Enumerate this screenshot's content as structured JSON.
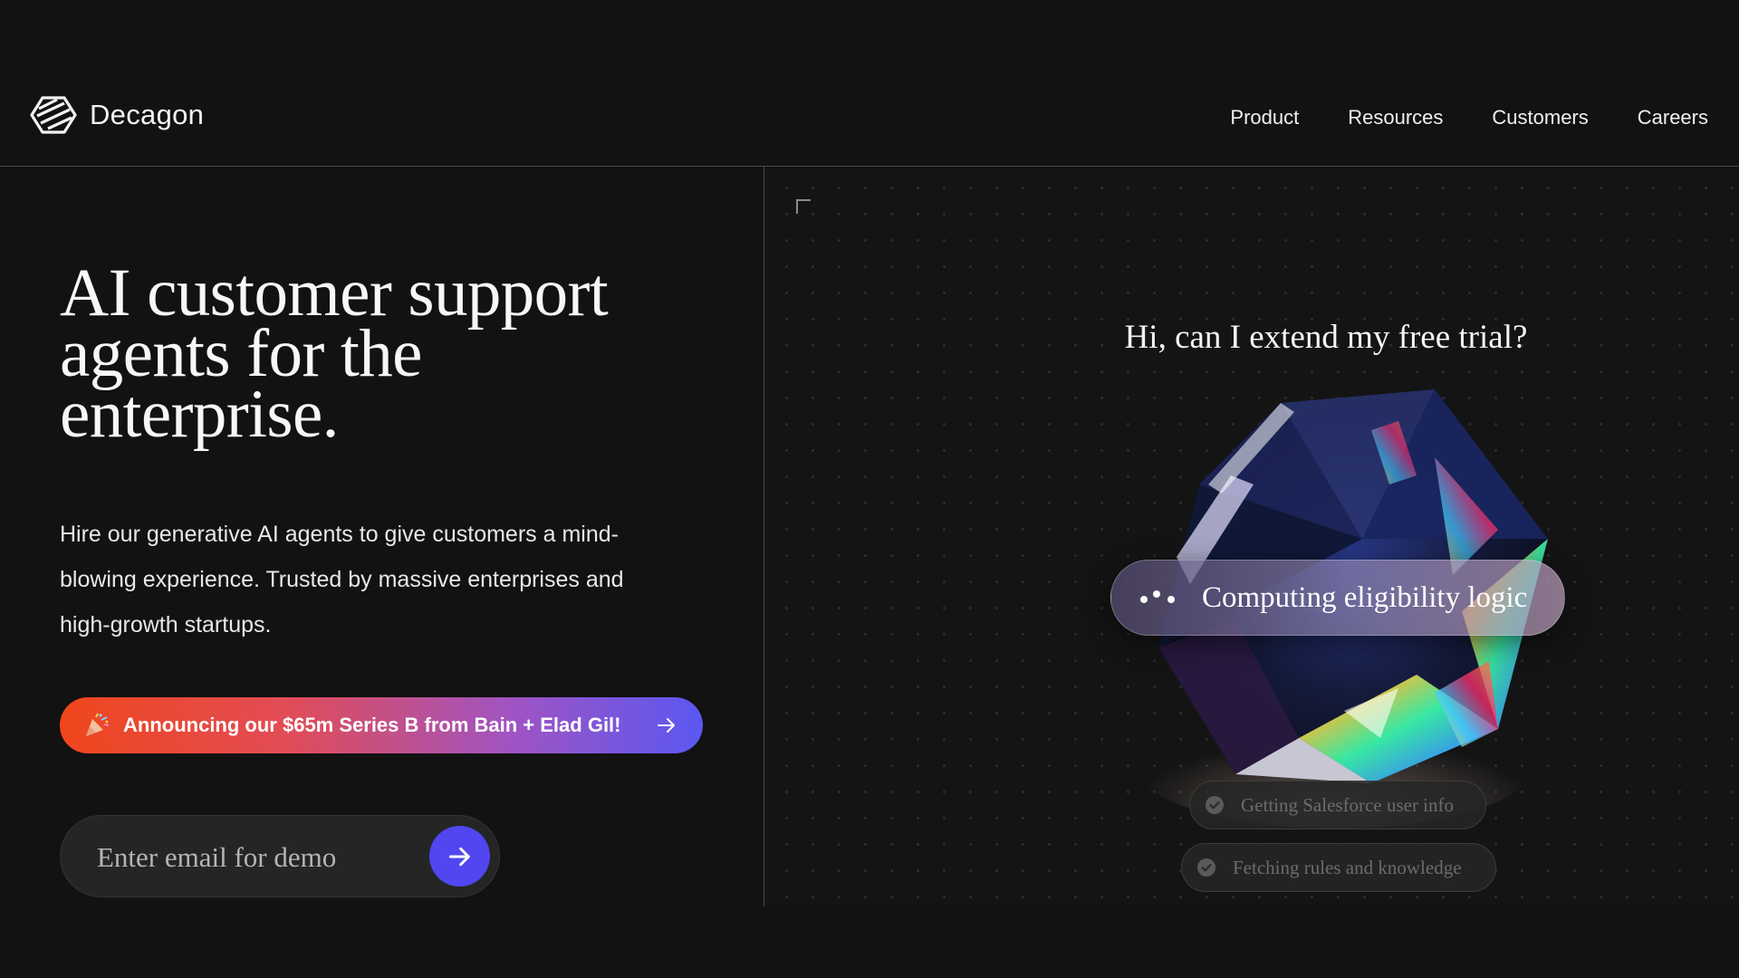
{
  "header": {
    "brand_name": "Decagon",
    "nav": [
      {
        "label": "Product"
      },
      {
        "label": "Resources"
      },
      {
        "label": "Customers"
      },
      {
        "label": "Careers"
      }
    ]
  },
  "hero": {
    "title": "AI customer support agents for the enterprise.",
    "description": "Hire our generative AI agents to give customers a mind-blowing experience. Trusted by massive enterprises and high-growth startups.",
    "announcement": {
      "label": "Announcing our $65m Series B from Bain + Elad Gil!",
      "icon": "party-popper-icon",
      "gradient_colors": [
        "#f0461c",
        "#e24c55",
        "#a054c2",
        "#5a58f2"
      ]
    },
    "email_form": {
      "placeholder": "Enter email for demo",
      "value": "",
      "submit_icon": "arrow-right-icon",
      "submit_color": "#5146f0"
    }
  },
  "demo": {
    "question": "Hi, can I extend my free trial?",
    "computing_label": "Computing eligibility logic",
    "steps": [
      {
        "label": "Getting Salesforce user info",
        "icon": "check-circle-icon"
      },
      {
        "label": "Fetching rules and knowledge",
        "icon": "check-circle-icon"
      }
    ]
  },
  "colors": {
    "background": "#121212",
    "divider": "#4a4a4a",
    "accent": "#5146f0"
  }
}
